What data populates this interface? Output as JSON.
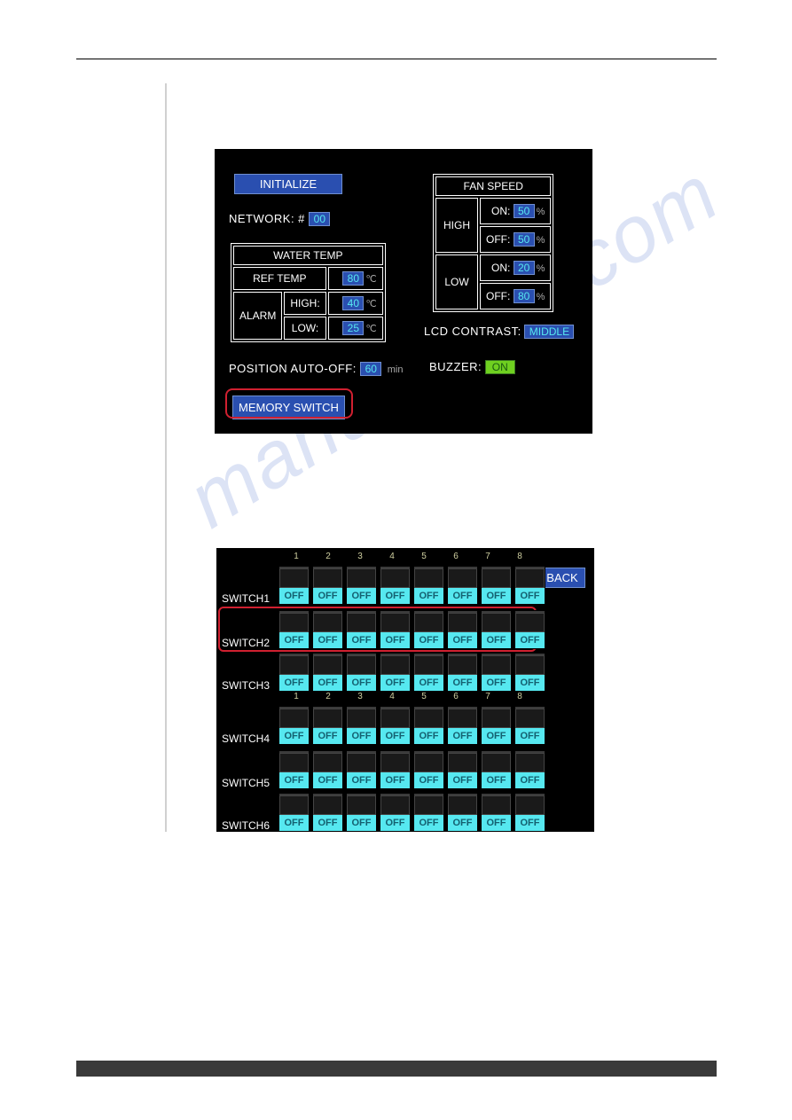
{
  "watermark": "manualhive.com",
  "panel1": {
    "initialize_label": "INITIALIZE",
    "network_label": "NETWORK: #",
    "network_value": "00",
    "water_temp": {
      "title": "WATER TEMP",
      "ref_label": "REF TEMP",
      "ref_value": "80",
      "ref_unit": "℃",
      "alarm_label": "ALARM",
      "high_label": "HIGH:",
      "high_value": "40",
      "high_unit": "℃",
      "low_label": "LOW:",
      "low_value": "25",
      "low_unit": "℃"
    },
    "pos_auto_off_label": "POSITION AUTO-OFF:",
    "pos_auto_off_value": "60",
    "pos_auto_off_unit": "min",
    "memory_switch_label": "MEMORY SWITCH",
    "fan_speed": {
      "title": "FAN SPEED",
      "high_label": "HIGH",
      "low_label": "LOW",
      "on_label": "ON:",
      "off_label": "OFF:",
      "high_on": "50",
      "high_off": "50",
      "low_on": "20",
      "low_off": "80",
      "unit": "%"
    },
    "lcd_label": "LCD CONTRAST:",
    "lcd_value": "MIDDLE",
    "buzzer_label": "BUZZER:",
    "buzzer_value": "ON"
  },
  "panel2": {
    "back_label": "BACK",
    "col_numbers": [
      "1",
      "2",
      "3",
      "4",
      "5",
      "6",
      "7",
      "8"
    ],
    "rows": [
      {
        "name": "SWITCH1",
        "cells": [
          "OFF",
          "OFF",
          "OFF",
          "OFF",
          "OFF",
          "OFF",
          "OFF",
          "OFF"
        ]
      },
      {
        "name": "SWITCH2",
        "cells": [
          "OFF",
          "OFF",
          "OFF",
          "OFF",
          "OFF",
          "OFF",
          "OFF",
          "OFF"
        ]
      },
      {
        "name": "SWITCH3",
        "cells": [
          "OFF",
          "OFF",
          "OFF",
          "OFF",
          "OFF",
          "OFF",
          "OFF",
          "OFF"
        ]
      },
      {
        "name": "SWITCH4",
        "cells": [
          "OFF",
          "OFF",
          "OFF",
          "OFF",
          "OFF",
          "OFF",
          "OFF",
          "OFF"
        ]
      },
      {
        "name": "SWITCH5",
        "cells": [
          "OFF",
          "OFF",
          "OFF",
          "OFF",
          "OFF",
          "OFF",
          "OFF",
          "OFF"
        ]
      },
      {
        "name": "SWITCH6",
        "cells": [
          "OFF",
          "OFF",
          "OFF",
          "OFF",
          "OFF",
          "OFF",
          "OFF",
          "OFF"
        ]
      }
    ]
  }
}
